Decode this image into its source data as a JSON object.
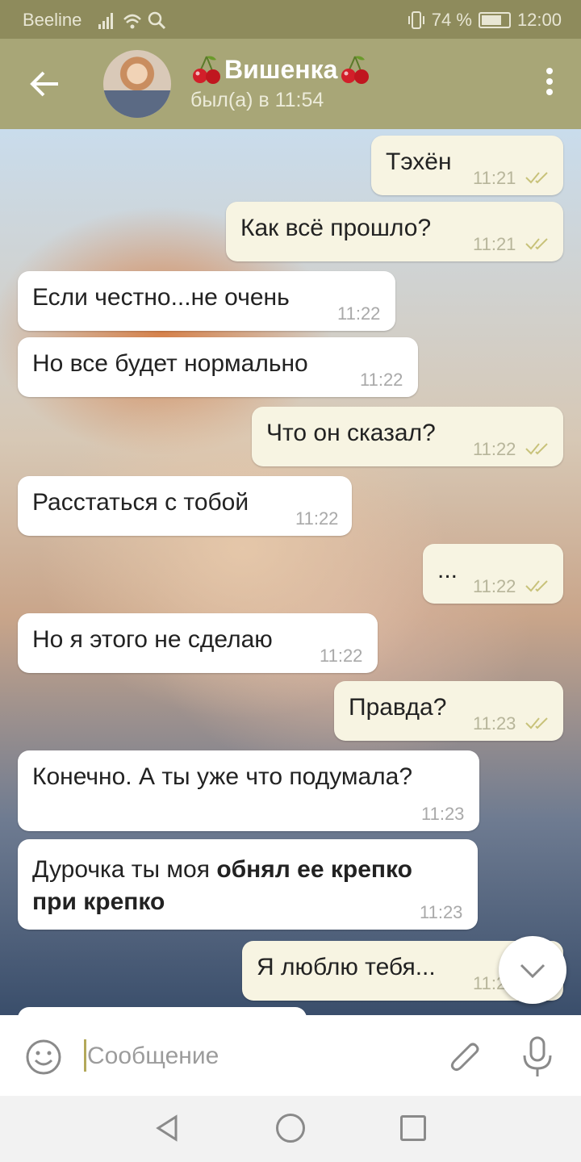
{
  "status_bar": {
    "carrier": "Beeline",
    "battery": "74 %",
    "battery_level": 0.74,
    "time": "12:00"
  },
  "header": {
    "name": "Вишенка",
    "status": "был(а) в 11:54"
  },
  "messages": [
    {
      "dir": "out",
      "text": "Тэхён",
      "time": "11:21"
    },
    {
      "dir": "out",
      "text": "Как всё прошло?",
      "time": "11:21"
    },
    {
      "dir": "in",
      "text": "Если честно...не очень",
      "time": "11:22"
    },
    {
      "dir": "in",
      "text": "Но все будет нормально",
      "time": "11:22"
    },
    {
      "dir": "out",
      "text": "Что он сказал?",
      "time": "11:22"
    },
    {
      "dir": "in",
      "text": "Расстаться с тобой",
      "time": "11:22"
    },
    {
      "dir": "out",
      "text": "...",
      "time": "11:22"
    },
    {
      "dir": "in",
      "text": "Но я этого не сделаю",
      "time": "11:22"
    },
    {
      "dir": "out",
      "text": "Правда?",
      "time": "11:23"
    },
    {
      "dir": "in",
      "text": "Конечно. А ты уже что подумала?",
      "time": "11:23"
    },
    {
      "dir": "in",
      "text": "Дурочка ты моя ",
      "text_bold_1": "обнял ее крепко",
      "text_bold_2": "при крепко",
      "time": "11:23"
    },
    {
      "dir": "out",
      "text": "Я люблю тебя...",
      "time": "11:2"
    }
  ],
  "input": {
    "placeholder": "Сообщение"
  },
  "colors": {
    "header_bg": "#a8a677",
    "status_bg": "#8e8b5c",
    "outgoing_bubble": "#f7f4e2",
    "incoming_bubble": "#ffffff",
    "read_ticks": "#c8c27a"
  },
  "icons": [
    "back-arrow-icon",
    "cherry-icon",
    "more-vertical-icon",
    "read-ticks-icon",
    "chevron-down-icon",
    "emoji-icon",
    "attach-icon",
    "mic-icon",
    "nav-back-icon",
    "nav-home-icon",
    "nav-recent-icon"
  ]
}
